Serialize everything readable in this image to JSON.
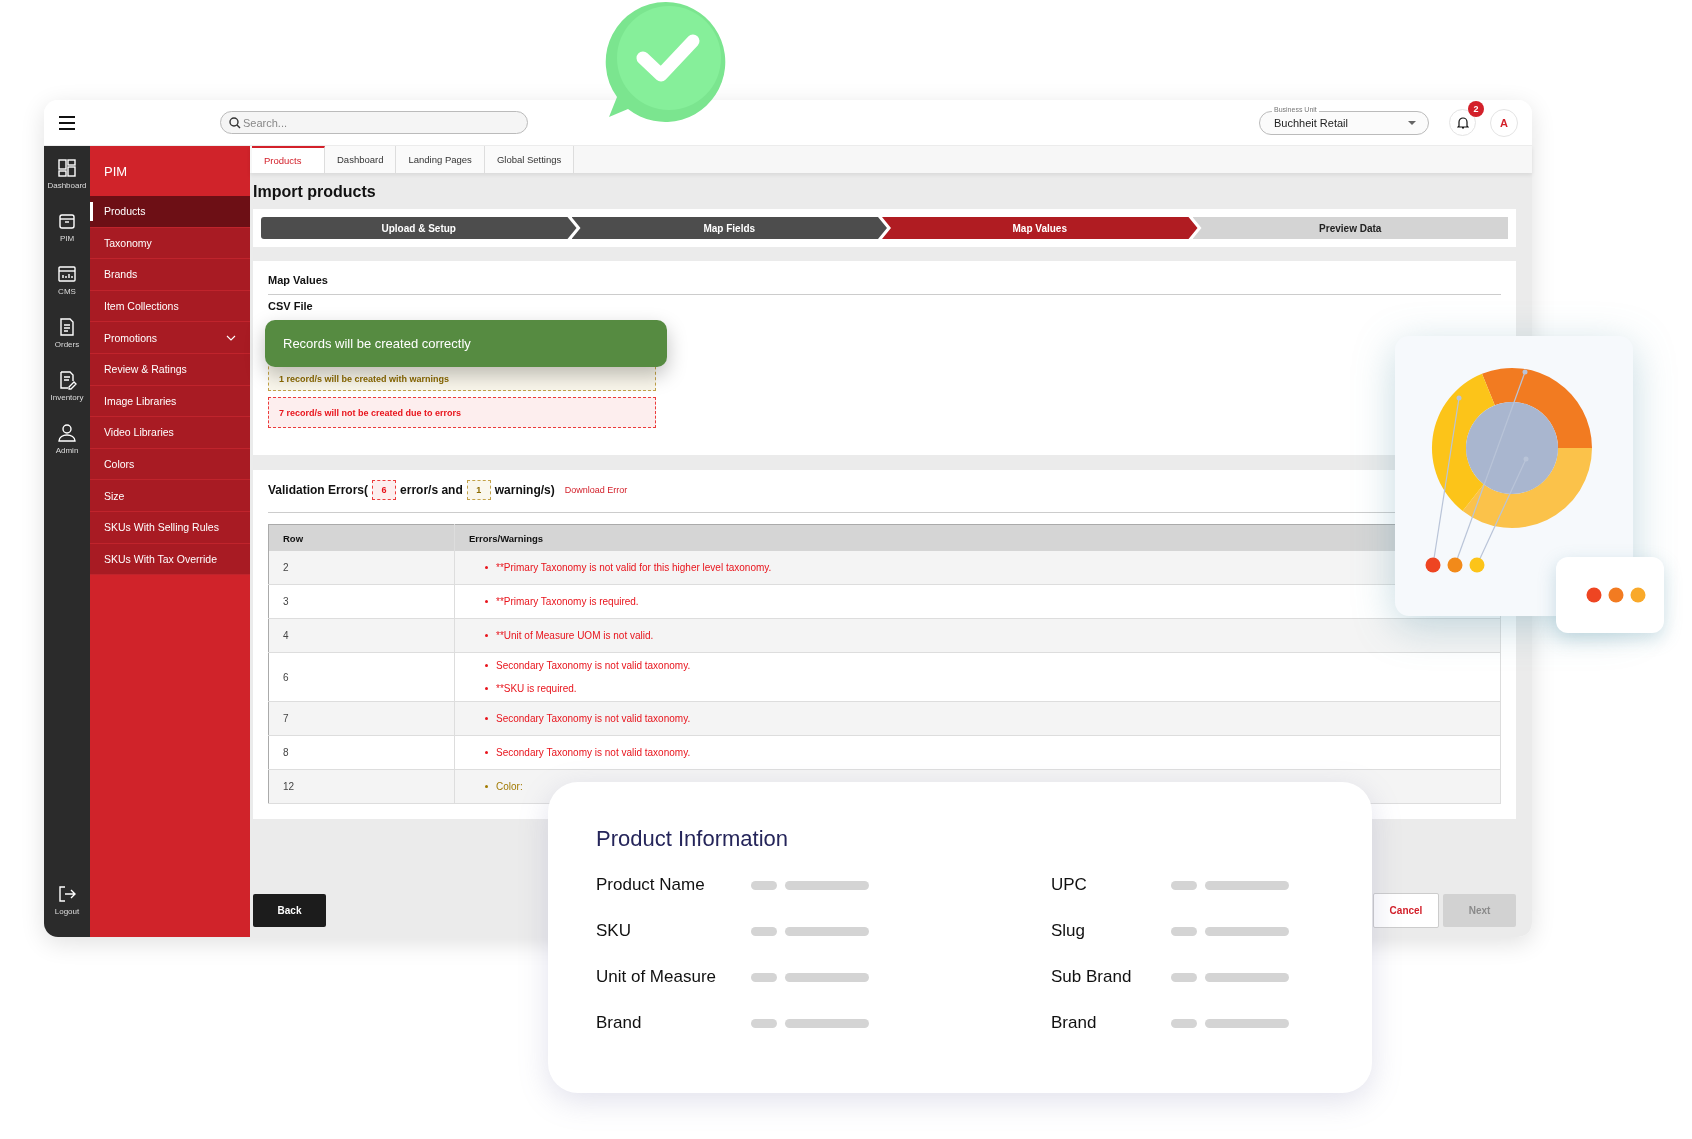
{
  "header": {
    "search": {
      "placeholder": "Search..."
    },
    "business_unit": {
      "label": "Business Unit",
      "value": "Buchheit Retail"
    },
    "notifications": {
      "count": "2"
    },
    "avatar": {
      "initial": "A"
    }
  },
  "nav_rail": {
    "items": [
      {
        "label": "Dashboard"
      },
      {
        "label": "PIM"
      },
      {
        "label": "CMS"
      },
      {
        "label": "Orders"
      },
      {
        "label": "Inventory"
      },
      {
        "label": "Admin"
      }
    ],
    "footer": {
      "label": "Logout"
    }
  },
  "side_menu": {
    "title": "PIM",
    "items": [
      {
        "label": "Products",
        "selected": true,
        "kind": "link"
      },
      {
        "label": "Taxonomy",
        "selected": false,
        "kind": "link"
      },
      {
        "label": "Brands",
        "selected": false,
        "kind": "link"
      },
      {
        "label": "Item Collections",
        "selected": false,
        "kind": "link"
      },
      {
        "label": "Promotions",
        "selected": false,
        "kind": "group"
      },
      {
        "label": "Review & Ratings",
        "selected": false,
        "kind": "link"
      },
      {
        "label": "Image Libraries",
        "selected": false,
        "kind": "link"
      },
      {
        "label": "Video Libraries",
        "selected": false,
        "kind": "link"
      },
      {
        "label": "Colors",
        "selected": false,
        "kind": "link"
      },
      {
        "label": "Size",
        "selected": false,
        "kind": "link"
      },
      {
        "label": "SKUs With Selling Rules",
        "selected": false,
        "kind": "link"
      },
      {
        "label": "SKUs With Tax Override",
        "selected": false,
        "kind": "link"
      }
    ]
  },
  "tabs": [
    {
      "label": "Products",
      "selected": true
    },
    {
      "label": "Dashboard",
      "selected": false
    },
    {
      "label": "Landing Pages",
      "selected": false
    },
    {
      "label": "Global Settings",
      "selected": false
    }
  ],
  "page_title": "Import products",
  "steps": [
    {
      "label": "Upload & Setup",
      "completed": true,
      "selected": false
    },
    {
      "label": "Map Fields",
      "completed": true,
      "selected": false
    },
    {
      "label": "Map Values",
      "completed": false,
      "selected": true
    },
    {
      "label": "Preview Data",
      "completed": false,
      "selected": false
    }
  ],
  "map_values": {
    "title": "Map Values",
    "file_label": "CSV File",
    "toast": "Records will be created correctly",
    "notices": [
      {
        "kind": "warning",
        "text": "1 record/s will be created with warnings"
      },
      {
        "kind": "error",
        "text": "7 record/s will not be created due to errors"
      }
    ]
  },
  "validation": {
    "title_start": "Validation Errors(",
    "error_count": "6",
    "title_middle": "error/s and",
    "warning_count": "1",
    "title_end": "warning/s)",
    "download_link": "Download Error",
    "table": {
      "columns": [
        "Row",
        "Errors/Warnings"
      ],
      "rows": [
        {
          "row": "2",
          "messages": [
            {
              "kind": "error",
              "text": "**Primary Taxonomy is not valid for this higher level taxonomy."
            }
          ]
        },
        {
          "row": "3",
          "messages": [
            {
              "kind": "error",
              "text": "**Primary Taxonomy is required."
            }
          ]
        },
        {
          "row": "4",
          "messages": [
            {
              "kind": "error",
              "text": "**Unit of Measure UOM is not valid."
            }
          ]
        },
        {
          "row": "6",
          "messages": [
            {
              "kind": "error",
              "text": "Secondary Taxonomy is not valid taxonomy."
            },
            {
              "kind": "error",
              "text": "**SKU is required."
            }
          ]
        },
        {
          "row": "7",
          "messages": [
            {
              "kind": "error",
              "text": "Secondary Taxonomy is not valid taxonomy."
            }
          ]
        },
        {
          "row": "8",
          "messages": [
            {
              "kind": "error",
              "text": "Secondary Taxonomy is not valid taxonomy."
            }
          ]
        },
        {
          "row": "12",
          "messages": [
            {
              "kind": "warning",
              "text": "Color:"
            }
          ]
        }
      ]
    }
  },
  "buttons": {
    "back": "Back",
    "cancel": "Cancel",
    "next": {
      "label": "Next",
      "disabled": true
    }
  },
  "product_info": {
    "title": "Product Information",
    "columns": [
      {
        "fields": [
          "Product Name",
          "SKU",
          "Unit of Measure",
          "Brand"
        ]
      },
      {
        "fields": [
          "UPC",
          "Slug",
          "Sub Brand",
          "Brand"
        ]
      }
    ]
  }
}
